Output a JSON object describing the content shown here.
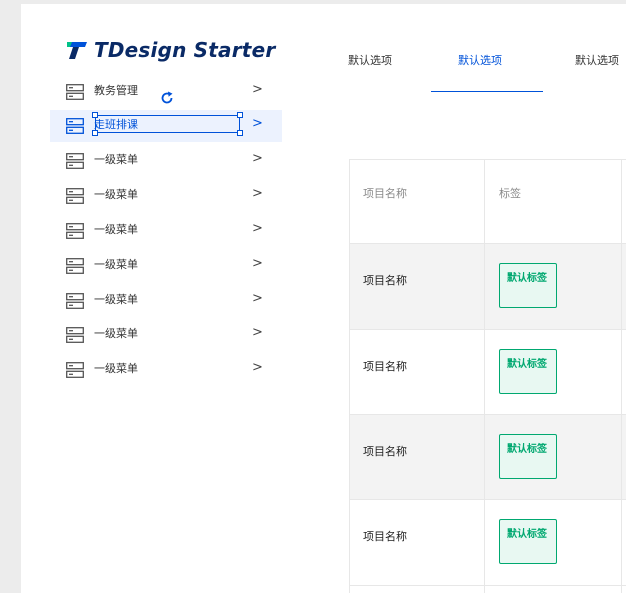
{
  "app": {
    "logo_text": "TDesign Starter",
    "accent_color": "#0052d9",
    "success_color": "#00a870"
  },
  "sidebar": {
    "items": [
      {
        "label": "教务管理",
        "icon": "server-icon",
        "active": false
      },
      {
        "label": "走班排课",
        "icon": "server-icon",
        "active": true
      },
      {
        "label": "一级菜单",
        "icon": "server-icon",
        "active": false
      },
      {
        "label": "一级菜单",
        "icon": "server-icon",
        "active": false
      },
      {
        "label": "一级菜单",
        "icon": "server-icon",
        "active": false
      },
      {
        "label": "一级菜单",
        "icon": "server-icon",
        "active": false
      },
      {
        "label": "一级菜单",
        "icon": "server-icon",
        "active": false
      },
      {
        "label": "一级菜单",
        "icon": "server-icon",
        "active": false
      },
      {
        "label": "一级菜单",
        "icon": "server-icon",
        "active": false
      }
    ],
    "arrow_glyph": ">"
  },
  "tabs": [
    {
      "label": "默认选项",
      "active": false
    },
    {
      "label": "默认选项",
      "active": true
    },
    {
      "label": "默认选项",
      "active": false
    }
  ],
  "table": {
    "headers": {
      "name": "项目名称",
      "tag": "标签"
    },
    "rows": [
      {
        "name": "项目名称",
        "tag": "默认标签"
      },
      {
        "name": "项目名称",
        "tag": "默认标签"
      },
      {
        "name": "项目名称",
        "tag": "默认标签"
      },
      {
        "name": "项目名称",
        "tag": "默认标签"
      }
    ]
  }
}
